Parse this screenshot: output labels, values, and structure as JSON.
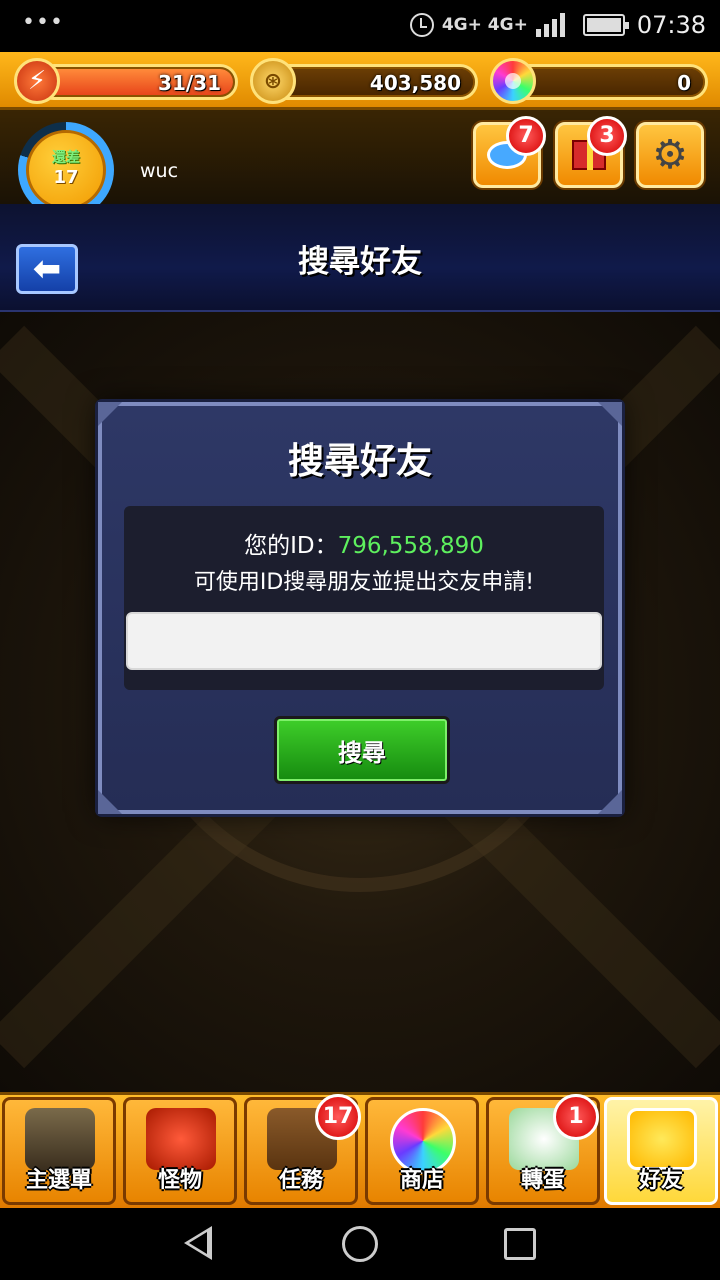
{
  "status_bar": {
    "network": "4G+ 4G+",
    "time": "07:38",
    "icons": [
      "menu-dots-icon",
      "alarm-icon",
      "signal-icon",
      "battery-icon"
    ]
  },
  "hud": {
    "stamina": "31/31",
    "stamina_fill": 1.0,
    "coins": "403,580",
    "orbs": "0",
    "rank_label": "還差",
    "rank": "17",
    "username": "wuc",
    "chat_badge": "7",
    "gift_badge": "3"
  },
  "titlebar": {
    "title": "搜尋好友",
    "back_icon": "back-arrow-icon"
  },
  "dialog": {
    "title": "搜尋好友",
    "id_label": "您的ID：",
    "id_value": "796,558,890",
    "hint": "可使用ID搜尋朋友並提出交友申請!",
    "input_value": "",
    "search_label": "搜尋"
  },
  "bottom_menu": {
    "items": [
      {
        "label": "主選單",
        "icon": "home-gate-icon"
      },
      {
        "label": "怪物",
        "icon": "monster-icon"
      },
      {
        "label": "任務",
        "icon": "quest-book-icon",
        "badge": "17"
      },
      {
        "label": "商店",
        "icon": "rainbow-orb-icon"
      },
      {
        "label": "轉蛋",
        "icon": "egg-icon",
        "badge": "1"
      },
      {
        "label": "好友",
        "icon": "friends-icon",
        "active": true
      }
    ]
  },
  "colors": {
    "accent_gold": "#ffb71b",
    "dialog_bg": "#2e3866",
    "id_green": "#5ef05e",
    "search_green": "#22a818",
    "badge_red": "#d40000"
  }
}
